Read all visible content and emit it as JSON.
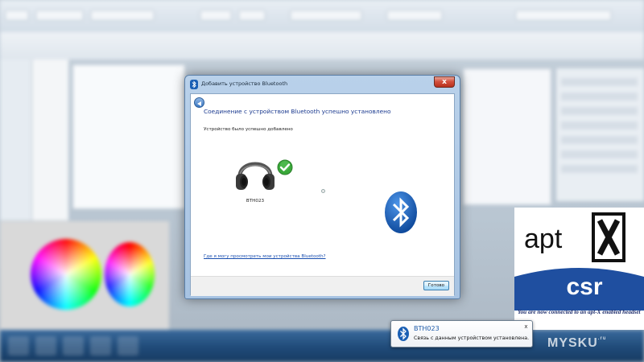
{
  "dialog": {
    "title": "Добавить устройство Bluetooth",
    "heading": "Соединение с устройством Bluetooth успешно установлено",
    "subtext": "Устройство было успешно добавлено",
    "device_name": "BTH023",
    "link": "Где я могу просмотреть мои устройства Bluetooth?",
    "done_label": "Готово",
    "close_glyph": "x"
  },
  "aptx": {
    "logo_text": "apt",
    "company": "csr",
    "caption": "You are now connected to an apt-X enabled headset"
  },
  "notification": {
    "title": "BTH023",
    "body": "Связь с данным устройством установлена.",
    "close_glyph": "x"
  },
  "watermark": {
    "text": "MYSKU",
    "suffix": ".ru"
  },
  "colors": {
    "bluetooth_blue": "#1a5fb4",
    "check_green": "#3aa83a",
    "csr_blue": "#1f4fa0",
    "link_blue": "#1a4fb0"
  },
  "icons": {
    "dialog_title": "bluetooth-icon",
    "device": "headphones-icon",
    "status": "checkmark-icon",
    "brand": "bluetooth-logo-icon"
  }
}
